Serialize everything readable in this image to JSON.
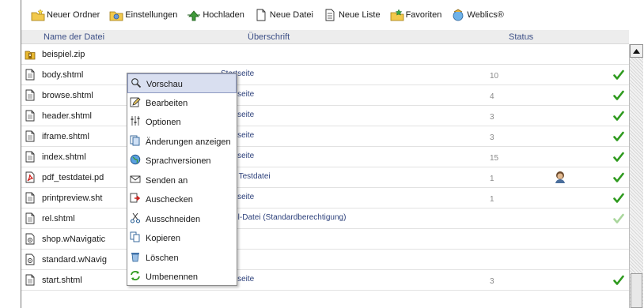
{
  "toolbar": {
    "buttons": [
      {
        "label": "Neuer Ordner",
        "icon": "new-folder-icon"
      },
      {
        "label": "Einstellungen",
        "icon": "settings-icon"
      },
      {
        "label": "Hochladen",
        "icon": "upload-icon"
      },
      {
        "label": "Neue Datei",
        "icon": "new-file-icon"
      },
      {
        "label": "Neue Liste",
        "icon": "new-list-icon"
      },
      {
        "label": "Favoriten",
        "icon": "favorites-icon"
      },
      {
        "label": "Weblics®",
        "icon": "weblics-icon"
      }
    ]
  },
  "columns": {
    "name": "Name der Datei",
    "title": "Überschrift",
    "status": "Status"
  },
  "rows": [
    {
      "name": "beispiel.zip",
      "title": "",
      "num": "",
      "type": "zip",
      "user": false,
      "check": ""
    },
    {
      "name": "body.shtml",
      "title": "Startseite",
      "num": "10",
      "type": "doc",
      "user": false,
      "check": "dark"
    },
    {
      "name": "browse.shtml",
      "title": "Startseite",
      "num": "4",
      "type": "doc",
      "user": false,
      "check": "dark"
    },
    {
      "name": "header.shtml",
      "title": "Startseite",
      "num": "3",
      "type": "doc",
      "user": false,
      "check": "dark"
    },
    {
      "name": "iframe.shtml",
      "title": "Startseite",
      "num": "3",
      "type": "doc",
      "user": false,
      "check": "dark"
    },
    {
      "name": "index.shtml",
      "title": "Startseite",
      "num": "15",
      "type": "doc",
      "user": false,
      "check": "dark"
    },
    {
      "name": "pdf_testdatei.pd",
      "title": "PDF Testdatei",
      "num": "1",
      "type": "pdf",
      "user": true,
      "check": "dark"
    },
    {
      "name": "printpreview.sht",
      "title": "Startseite",
      "num": "1",
      "type": "doc",
      "user": false,
      "check": "dark"
    },
    {
      "name": "rel.shtml",
      "title": "shtml-Datei (Standardberechtigung)",
      "num": "",
      "type": "doc",
      "user": false,
      "check": "light"
    },
    {
      "name": "shop.wNavigatic",
      "title": "",
      "num": "",
      "type": "nav",
      "user": false,
      "check": ""
    },
    {
      "name": "standard.wNavig",
      "title": "",
      "num": "",
      "type": "nav",
      "user": false,
      "check": ""
    },
    {
      "name": "start.shtml",
      "title": "Startseite",
      "num": "3",
      "type": "doc",
      "user": false,
      "check": "dark"
    }
  ],
  "context_menu": {
    "items": [
      {
        "label": "Vorschau",
        "icon": "magnifier-icon",
        "active": true
      },
      {
        "label": "Bearbeiten",
        "icon": "edit-icon",
        "active": false
      },
      {
        "label": "Optionen",
        "icon": "options-icon",
        "active": false
      },
      {
        "label": "Änderungen anzeigen",
        "icon": "changes-icon",
        "active": false
      },
      {
        "label": "Sprachversionen",
        "icon": "globe-icon",
        "active": false
      },
      {
        "label": "Senden an",
        "icon": "envelope-icon",
        "active": false
      },
      {
        "label": "Auschecken",
        "icon": "checkout-icon",
        "active": false
      },
      {
        "label": "Ausschneiden",
        "icon": "scissors-icon",
        "active": false
      },
      {
        "label": "Kopieren",
        "icon": "copy-icon",
        "active": false
      },
      {
        "label": "Löschen",
        "icon": "trash-icon",
        "active": false
      },
      {
        "label": "Umbenennen",
        "icon": "rename-icon",
        "active": false
      }
    ]
  },
  "colors": {
    "check_dark": "#2e9a1e",
    "check_light": "#a9d69c",
    "link_text": "#2b3f7a",
    "header_text": "#3b4e86",
    "menu_highlight": "#d9dff0"
  }
}
